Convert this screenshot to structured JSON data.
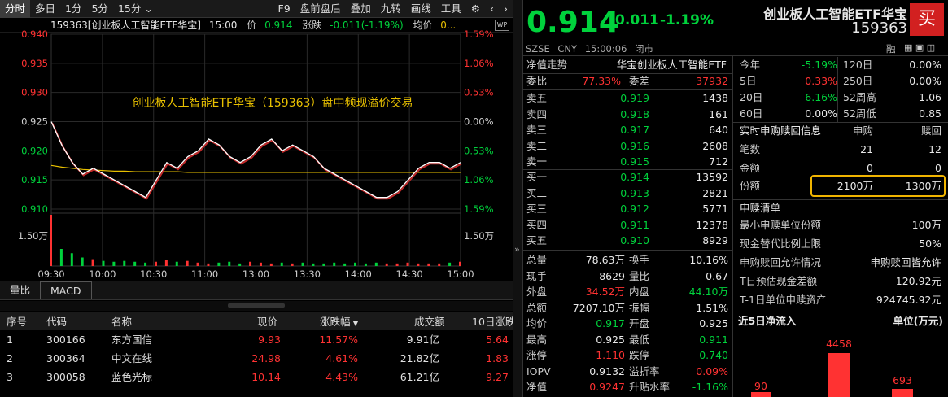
{
  "toolbar": {
    "items": [
      "分时",
      "多日",
      "1分",
      "5分",
      "15分",
      "F9",
      "盘前盘后",
      "叠加",
      "九转",
      "画线",
      "工具"
    ],
    "active": "分时"
  },
  "info": {
    "code_name": "159363[创业板人工智能ETF华宝]",
    "time": "15:00",
    "price_label": "价",
    "price": "0.914",
    "change_label": "涨跌",
    "change": "-0.011(-1.19%)",
    "avg_label": "均价",
    "avg": "0..."
  },
  "chart": {
    "title": "创业板人工智能ETF华宝（159363）盘中频现溢价交易",
    "left_ticks": [
      "0.940",
      "0.935",
      "0.930",
      "0.925",
      "0.920",
      "0.915",
      "0.910",
      "1.50万"
    ],
    "right_ticks": [
      "1.59%",
      "1.06%",
      "0.53%",
      "0.00%",
      "0.53%",
      "1.06%",
      "1.59%",
      "1.50万"
    ],
    "x_ticks": [
      "09:30",
      "10:00",
      "10:30",
      "11:00",
      "13:00",
      "13:30",
      "14:00",
      "14:30",
      "15:00"
    ]
  },
  "chart_data": {
    "type": "line",
    "prev_close": 0.925,
    "ylim": [
      0.91,
      0.94
    ],
    "price": [
      0.925,
      0.921,
      0.918,
      0.916,
      0.917,
      0.916,
      0.915,
      0.914,
      0.913,
      0.912,
      0.915,
      0.918,
      0.917,
      0.919,
      0.92,
      0.922,
      0.921,
      0.919,
      0.918,
      0.919,
      0.921,
      0.922,
      0.92,
      0.921,
      0.92,
      0.919,
      0.917,
      0.916,
      0.915,
      0.914,
      0.913,
      0.912,
      0.912,
      0.913,
      0.915,
      0.917,
      0.918,
      0.918,
      0.917,
      0.918
    ],
    "avg": [
      0.9175,
      0.9172,
      0.917,
      0.9168,
      0.9167,
      0.9166,
      0.9165,
      0.9165,
      0.9164,
      0.9164,
      0.9164,
      0.9164,
      0.9164,
      0.9163,
      0.9163,
      0.9163,
      0.9163,
      0.9163,
      0.9163,
      0.9163,
      0.9163,
      0.9163,
      0.9163,
      0.9163,
      0.9163,
      0.9163,
      0.9163,
      0.9163,
      0.9163,
      0.9163,
      0.9163,
      0.9163,
      0.9163,
      0.9163,
      0.9163,
      0.9163,
      0.9163,
      0.9163,
      0.9163,
      0.9163
    ],
    "volume": [
      6,
      2,
      1.5,
      1,
      0.8,
      0.6,
      0.5,
      0.6,
      0.5,
      0.4,
      0.5,
      0.7,
      0.5,
      0.6,
      0.4,
      0.3,
      0.4,
      0.5,
      0.3,
      0.5,
      0.4,
      0.3,
      0.4,
      0.3,
      0.4,
      0.3,
      0.3,
      0.4,
      0.3,
      0.4,
      0.3,
      0.4,
      0.3,
      0.3,
      0.4,
      0.3,
      0.3,
      0.3,
      0.4,
      0.5
    ]
  },
  "subtabs": [
    "量比",
    "MACD"
  ],
  "table": {
    "headers": [
      "序号",
      "代码",
      "名称",
      "现价",
      "涨跌幅",
      "成交额",
      "10日涨跌"
    ],
    "rows": [
      [
        "1",
        "300166",
        "东方国信",
        "9.93",
        "11.57%",
        "9.91亿",
        "5.64"
      ],
      [
        "2",
        "300364",
        "中文在线",
        "24.98",
        "4.61%",
        "21.82亿",
        "1.83"
      ],
      [
        "3",
        "300058",
        "蓝色光标",
        "10.14",
        "4.43%",
        "61.21亿",
        "9.27"
      ]
    ]
  },
  "quote": {
    "price": "0.914",
    "change": "-0.011",
    "pct": "-1.19%",
    "name": "创业板人工智能ETF华宝",
    "code": "159363",
    "buy_label": "买",
    "market": "SZSE",
    "currency": "CNY",
    "timestamp": "15:00:06",
    "status": "闭市",
    "rong": "融"
  },
  "orderbook": {
    "nav_label": "净值走势",
    "fund_name": "华宝创业板人工智能ETF",
    "weibi_label": "委比",
    "weibi": "77.33%",
    "weicha_label": "委差",
    "weicha": "37932",
    "sell": [
      [
        "卖五",
        "0.919",
        "1438"
      ],
      [
        "卖四",
        "0.918",
        "161"
      ],
      [
        "卖三",
        "0.917",
        "640"
      ],
      [
        "卖二",
        "0.916",
        "2608"
      ],
      [
        "卖一",
        "0.915",
        "712"
      ]
    ],
    "buy": [
      [
        "买一",
        "0.914",
        "13592"
      ],
      [
        "买二",
        "0.913",
        "2821"
      ],
      [
        "买三",
        "0.912",
        "5771"
      ],
      [
        "买四",
        "0.911",
        "12378"
      ],
      [
        "买五",
        "0.910",
        "8929"
      ]
    ]
  },
  "stats": [
    [
      "总量",
      "78.63万",
      "换手",
      "10.16%"
    ],
    [
      "现手",
      "8629",
      "量比",
      "0.67"
    ],
    [
      "外盘",
      "34.52万",
      "内盘",
      "44.10万"
    ],
    [
      "总额",
      "7207.10万",
      "振幅",
      "1.51%"
    ],
    [
      "均价",
      "0.917",
      "开盘",
      "0.925"
    ],
    [
      "最高",
      "0.925",
      "最低",
      "0.911"
    ],
    [
      "涨停",
      "1.110",
      "跌停",
      "0.740"
    ],
    [
      "IOPV",
      "0.9132",
      "溢折率",
      "0.09%"
    ],
    [
      "净值",
      "0.9247",
      "升贴水率",
      "-1.16%"
    ]
  ],
  "perf": [
    [
      "今年",
      "-5.19%",
      "120日",
      "0.00%"
    ],
    [
      "5日",
      "0.33%",
      "250日",
      "0.00%"
    ],
    [
      "20日",
      "-6.16%",
      "52周高",
      "1.06"
    ],
    [
      "60日",
      "0.00%",
      "52周低",
      "0.85"
    ]
  ],
  "subscribe": {
    "header": "实时申购赎回信息",
    "col1": "申购",
    "col2": "赎回",
    "rows": [
      [
        "笔数",
        "21",
        "12"
      ],
      [
        "金额",
        "0",
        "0"
      ],
      [
        "份额",
        "2100万",
        "1300万"
      ]
    ]
  },
  "list": {
    "header": "申赎清单",
    "rows": [
      [
        "最小申赎单位份额",
        "100万"
      ],
      [
        "现金替代比例上限",
        "50%"
      ],
      [
        "申购赎回允许情况",
        "申购赎回皆允许"
      ],
      [
        "T日预估现金差额",
        "120.92元"
      ],
      [
        "T-1日单位申赎资产",
        "924745.92元"
      ]
    ]
  },
  "netflow": {
    "title": "近5日净流入",
    "unit": "单位(万元)",
    "values": [
      "90",
      "4458",
      "693"
    ]
  },
  "colors": {
    "up": "#ff3232",
    "down": "#00d23c",
    "highlight": "#f0b400",
    "avg_line": "#e8c000"
  }
}
